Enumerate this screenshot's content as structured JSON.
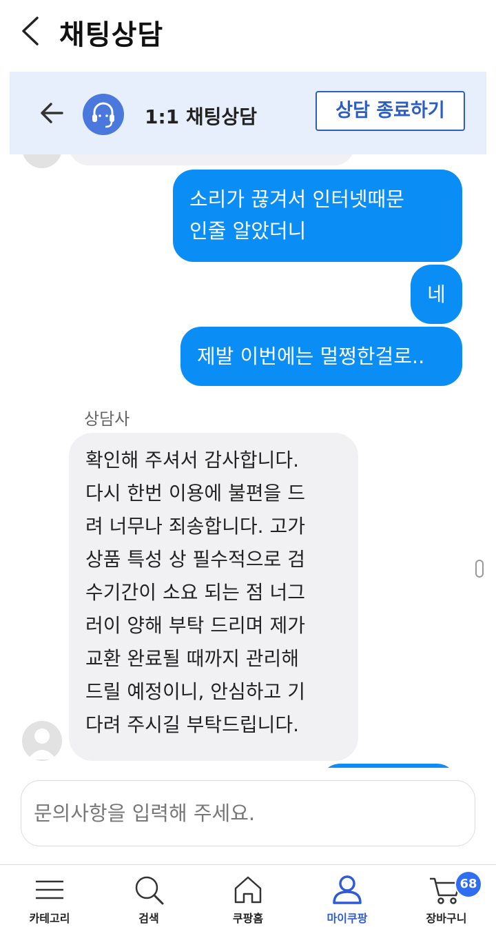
{
  "app": {
    "title": "채팅상담"
  },
  "chat_header": {
    "title": "1:1 채팅상담",
    "end_button": "상담 종료하기"
  },
  "messages": {
    "out1": [
      "소리가 끊겨서 인터넷때문",
      "인줄 알았더니"
    ],
    "out2": "네",
    "out3": "제발 이번에는 멀쩡한걸로..",
    "sender_name": "상담사",
    "in1": [
      "확인해 주셔서 감사합니다.",
      "다시 한번 이용에 불편을 드",
      "려 너무나 죄송합니다. 고가",
      "상품 특성 상 필수적으로 검",
      "수기간이 소요 되는 점 너그",
      "러이 양해 부탁 드리며 제가",
      "교환 완료될 때까지 관리해",
      "드릴 예정이니, 안심하고 기",
      "다려 주시길 부탁드립니다."
    ]
  },
  "input": {
    "placeholder": "문의사항을 입력해 주세요."
  },
  "bottom_nav": {
    "items": [
      {
        "label": "카테고리",
        "icon": "menu-icon"
      },
      {
        "label": "검색",
        "icon": "search-icon"
      },
      {
        "label": "쿠팡홈",
        "icon": "home-icon"
      },
      {
        "label": "마이쿠팡",
        "icon": "user-icon"
      },
      {
        "label": "장바구니",
        "icon": "cart-icon"
      }
    ],
    "cart_badge": "68",
    "active": "마이쿠팡"
  },
  "colors": {
    "accent": "#0a8ef5",
    "brand_blue": "#2c5cc5",
    "header_bg": "#e8effc",
    "incoming_bg": "#f1f1f3"
  }
}
